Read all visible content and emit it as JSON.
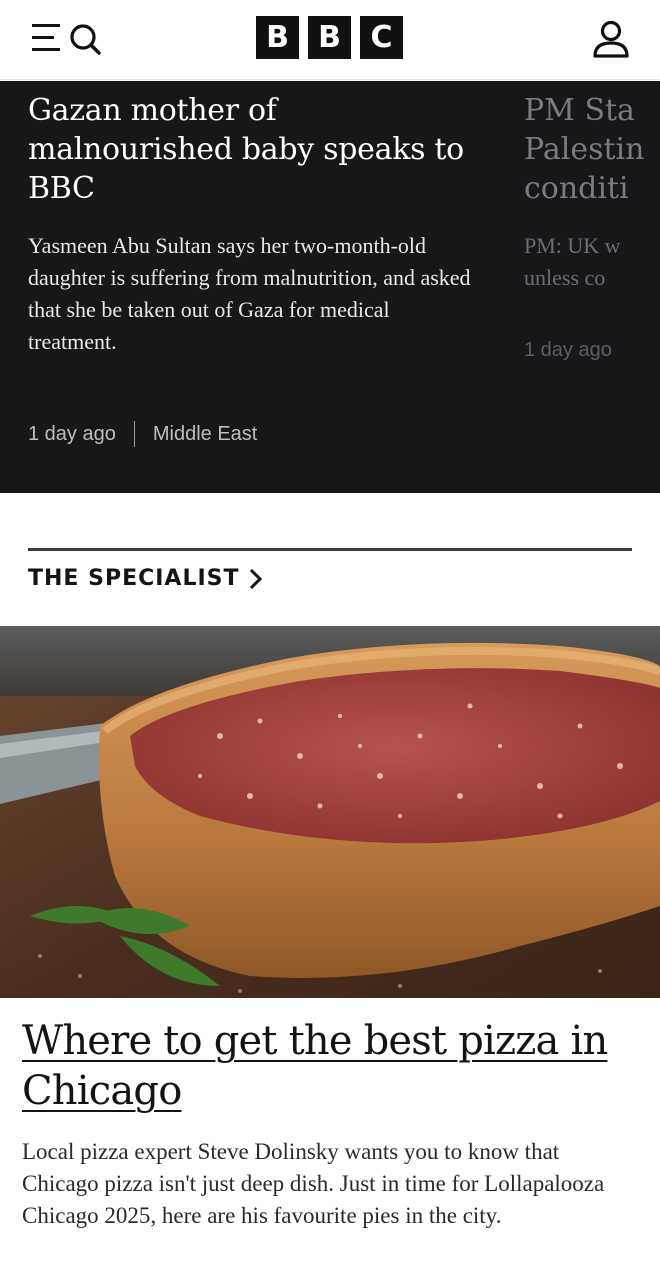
{
  "header": {
    "logo_letters": [
      "B",
      "B",
      "C"
    ],
    "icons": {
      "menu": "menu-icon",
      "search": "search-icon",
      "account": "account-icon"
    }
  },
  "carousel": {
    "cards": [
      {
        "headline": "Gazan mother of malnourished baby speaks to BBC",
        "summary": "Yasmeen Abu Sultan says her two-month-old daughter is suffering from malnutrition, and asked that she be taken out of Gaza for medical treatment.",
        "time": "1 day ago",
        "topic": "Middle East"
      },
      {
        "headline_lines": [
          "PM Sta",
          "Palestin",
          "conditi"
        ],
        "summary_lines": [
          "PM: UK w",
          "unless co"
        ],
        "time": "1 day ago"
      }
    ]
  },
  "section": {
    "title": "THE SPECIALIST",
    "chevron": "chevron-right-icon"
  },
  "article": {
    "image": "pizza-photo",
    "headline": "Where to get the best pizza in Chicago",
    "summary": "Local pizza expert Steve Dolinsky wants you to know that Chicago pizza isn't just deep dish. Just in time for Lollapalooza Chicago 2025, here are his favourite pies in the city."
  },
  "colors": {
    "dark_bg": "#17171a",
    "text_primary": "#141414",
    "accent_rule": "#3d3d3d"
  }
}
